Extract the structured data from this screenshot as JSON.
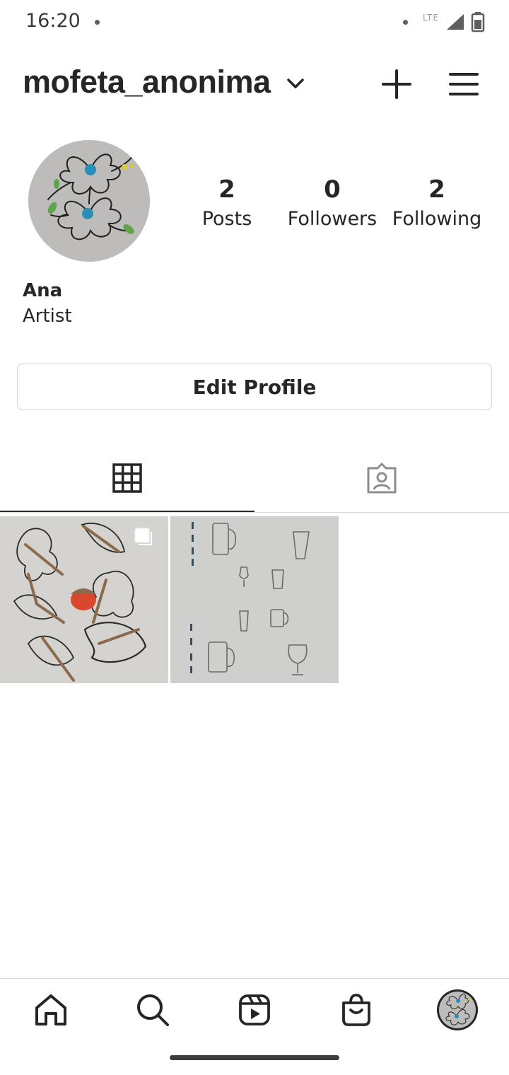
{
  "status_bar": {
    "time": "16:20",
    "network": "LTE",
    "icons": [
      "notification-dot-icon",
      "signal-icon",
      "battery-icon"
    ]
  },
  "header": {
    "username": "mofeta_anonima",
    "icons": [
      "chevron-down-icon",
      "plus-icon",
      "menu-icon"
    ]
  },
  "profile": {
    "stats": [
      {
        "value": "2",
        "label": "Posts"
      },
      {
        "value": "0",
        "label": "Followers"
      },
      {
        "value": "2",
        "label": "Following"
      }
    ],
    "name": "Ana",
    "bio": "Artist"
  },
  "edit_profile_label": "Edit Profile",
  "tabs": [
    {
      "icon": "grid-icon",
      "active": true
    },
    {
      "icon": "tagged-icon",
      "active": false
    }
  ],
  "posts": [
    {
      "subject": "leaves-and-acorn-drawing",
      "multiple": true
    },
    {
      "subject": "glasses-sketch-drawing",
      "multiple": false
    }
  ],
  "bottom_nav": [
    "home-icon",
    "search-icon",
    "reels-icon",
    "shop-icon",
    "profile-avatar"
  ],
  "colors": {
    "text": "#262626",
    "border": "#dbdbdb",
    "acorn": "#d9472f"
  }
}
